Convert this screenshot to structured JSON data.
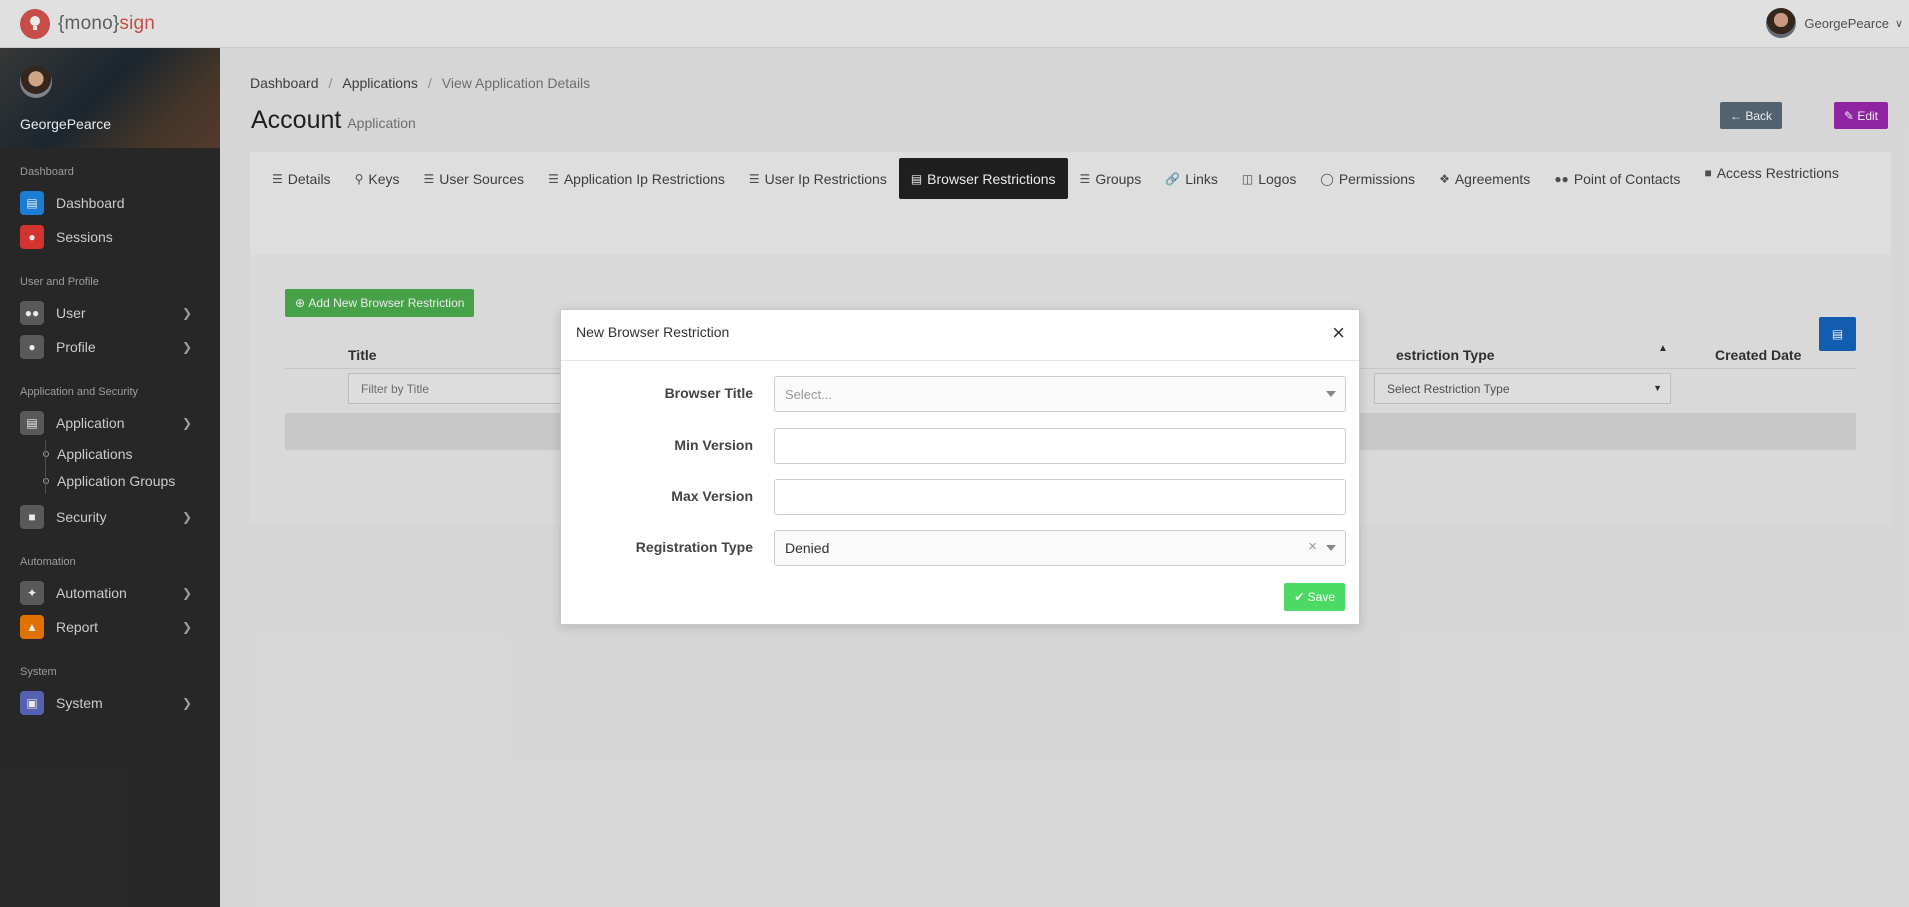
{
  "app": {
    "logo_prefix": "{mono}",
    "logo_suffix": "sign"
  },
  "topbar": {
    "username": "GeorgePearce"
  },
  "sidebar": {
    "profile_name": "GeorgePearce",
    "sections": {
      "dashboard": "Dashboard",
      "user_profile": "User and Profile",
      "app_security": "Application and Security",
      "automation": "Automation",
      "system": "System"
    },
    "items": {
      "dashboard": "Dashboard",
      "sessions": "Sessions",
      "user": "User",
      "profile": "Profile",
      "application": "Application",
      "applications": "Applications",
      "application_groups": "Application Groups",
      "security": "Security",
      "automation": "Automation",
      "report": "Report",
      "system": "System"
    },
    "colors": {
      "dashboard": "#1e88e5",
      "sessions": "#e53935",
      "user": "#616161",
      "profile": "#616161",
      "application": "#616161",
      "security": "#616161",
      "automation": "#616161",
      "report": "#f57c00",
      "system": "#5c6bc0"
    }
  },
  "breadcrumb": {
    "items": [
      "Dashboard",
      "Applications",
      "View Application Details"
    ]
  },
  "page": {
    "title": "Account",
    "subtitle": "Application"
  },
  "actions": {
    "back": "Back",
    "edit": "Edit"
  },
  "tabs": [
    {
      "label": "Details",
      "icon": "list-icon"
    },
    {
      "label": "Keys",
      "icon": "key-icon"
    },
    {
      "label": "User Sources",
      "icon": "list-icon"
    },
    {
      "label": "Application Ip Restrictions",
      "icon": "list-icon"
    },
    {
      "label": "User Ip Restrictions",
      "icon": "list-icon"
    },
    {
      "label": "Browser Restrictions",
      "icon": "browser-icon",
      "active": true
    },
    {
      "label": "Groups",
      "icon": "list-icon"
    },
    {
      "label": "Links",
      "icon": "link-icon"
    },
    {
      "label": "Logos",
      "icon": "images-icon"
    },
    {
      "label": "Permissions",
      "icon": "toggle-icon"
    },
    {
      "label": "Agreements",
      "icon": "handshake-icon"
    },
    {
      "label": "Point of Contacts",
      "icon": "users-icon"
    },
    {
      "label": "Access Restrictions",
      "icon": "lock-icon"
    }
  ],
  "grid": {
    "add_button": "Add New Browser Restriction",
    "columns": {
      "title": "Title",
      "restriction_type": "estriction Type",
      "created_date": "Created Date"
    },
    "filters": {
      "title_placeholder": "Filter by Title",
      "restriction_type": "Select Restriction Type"
    }
  },
  "modal": {
    "title": "New Browser Restriction",
    "fields": {
      "browser_title": {
        "label": "Browser Title",
        "placeholder": "Select..."
      },
      "min_version": {
        "label": "Min Version",
        "value": ""
      },
      "max_version": {
        "label": "Max Version",
        "value": ""
      },
      "registration_type": {
        "label": "Registration Type",
        "value": "Denied"
      }
    },
    "save": "Save"
  }
}
